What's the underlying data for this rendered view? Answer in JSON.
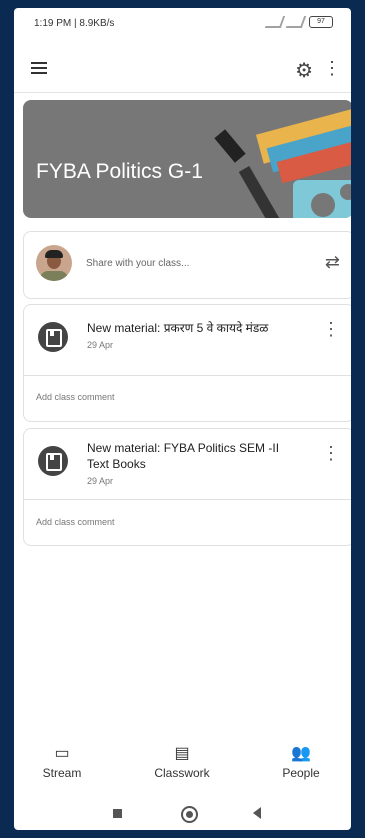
{
  "status_bar": {
    "time": "1:19 PM | 8.9KB/s",
    "battery": "97"
  },
  "class": {
    "title": "FYBA Politics G-1"
  },
  "share": {
    "placeholder": "Share with your class..."
  },
  "posts": [
    {
      "title": "New material: प्रकरण 5 वे कायदे मंडळ",
      "date": "29 Apr",
      "comment_placeholder": "Add class comment"
    },
    {
      "title": "New material: FYBA Politics SEM -II Text Books",
      "date": "29 Apr",
      "comment_placeholder": "Add class comment"
    }
  ],
  "bottom_nav": [
    {
      "label": "Stream",
      "icon": "stream-icon"
    },
    {
      "label": "Classwork",
      "icon": "classwork-icon"
    },
    {
      "label": "People",
      "icon": "people-icon"
    }
  ]
}
